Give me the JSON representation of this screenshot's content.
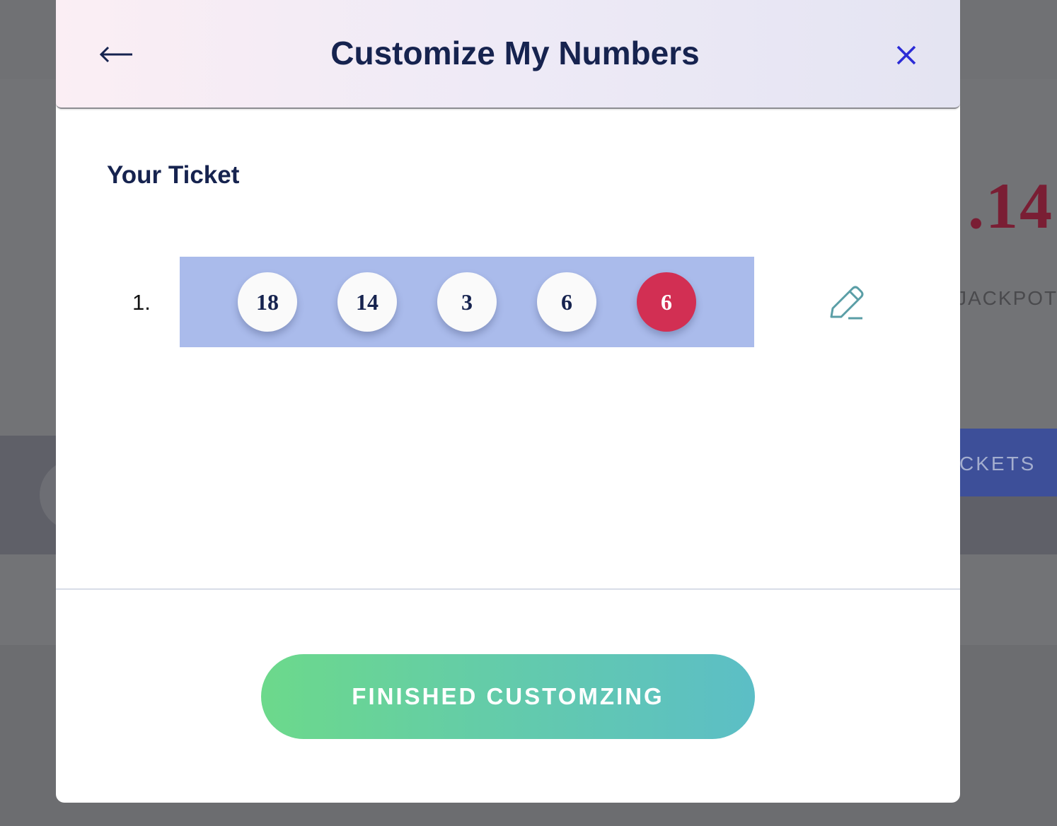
{
  "background": {
    "jackpot_amount_partial": ".14",
    "jackpot_label_partial": "JACKPOT",
    "tickets_button_partial": "CKETS"
  },
  "modal": {
    "title": "Customize My Numbers",
    "back_icon": "arrow-left-icon",
    "close_icon": "close-icon",
    "section_heading": "Your Ticket",
    "tickets": [
      {
        "index": "1.",
        "numbers": [
          "18",
          "14",
          "3",
          "6"
        ],
        "bonus": "6"
      }
    ],
    "edit_icon": "pencil-icon",
    "finish_button": "FINISHED CUSTOMZING"
  },
  "colors": {
    "title": "#16234f",
    "ticket_strip": "#aabbeb",
    "bonus_ball": "#d22f53",
    "button_gradient_start": "#6cd98b",
    "button_gradient_end": "#5cbec6",
    "close_icon": "#2b2bd6",
    "edit_icon": "#5a9ea6"
  }
}
